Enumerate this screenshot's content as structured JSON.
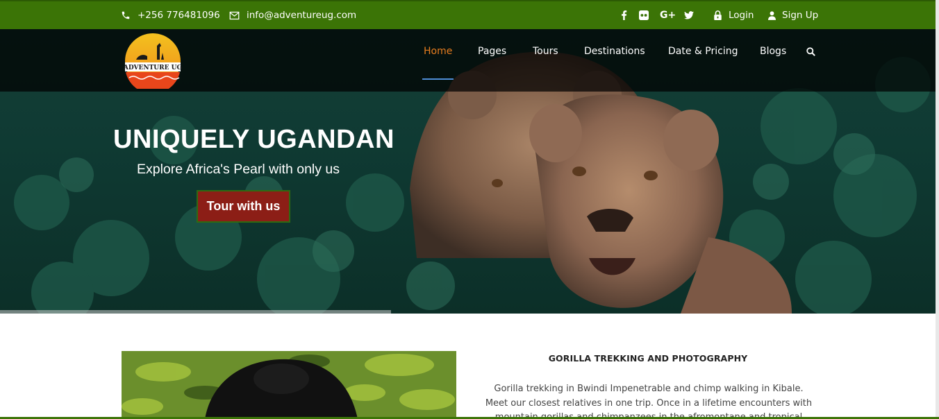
{
  "topbar": {
    "phone": "+256 776481096",
    "email": "info@adventureug.com",
    "social_icons": [
      "facebook-icon",
      "flickr-icon",
      "google-plus-icon",
      "twitter-icon"
    ],
    "login_label": "Login",
    "signup_label": "Sign Up"
  },
  "brand": {
    "logo_text": "ADVENTURE UG"
  },
  "nav": {
    "items": [
      {
        "label": "Home",
        "active": true
      },
      {
        "label": "Pages"
      },
      {
        "label": "Tours"
      },
      {
        "label": "Destinations"
      },
      {
        "label": "Date & Pricing"
      },
      {
        "label": "Blogs"
      }
    ],
    "search_icon": "search-icon"
  },
  "hero": {
    "title": "UNIQUELY UGANDAN",
    "subtitle": "Explore Africa's Pearl with only us",
    "cta_label": "Tour with us"
  },
  "section": {
    "title": "GORILLA TREKKING AND PHOTOGRAPHY",
    "text": "Gorilla trekking in Bwindi Impenetrable and chimp walking in Kibale. Meet our closest relatives in one trip. Once in a lifetime encounters with mountain gorillas and chimpanzees in the afromontane and tropical rainforests of"
  },
  "colors": {
    "topbar_green": "#3b7406",
    "nav_active": "#e77d1f",
    "cta_red": "#8c1e16",
    "nav_underline": "#4f8fd8"
  }
}
